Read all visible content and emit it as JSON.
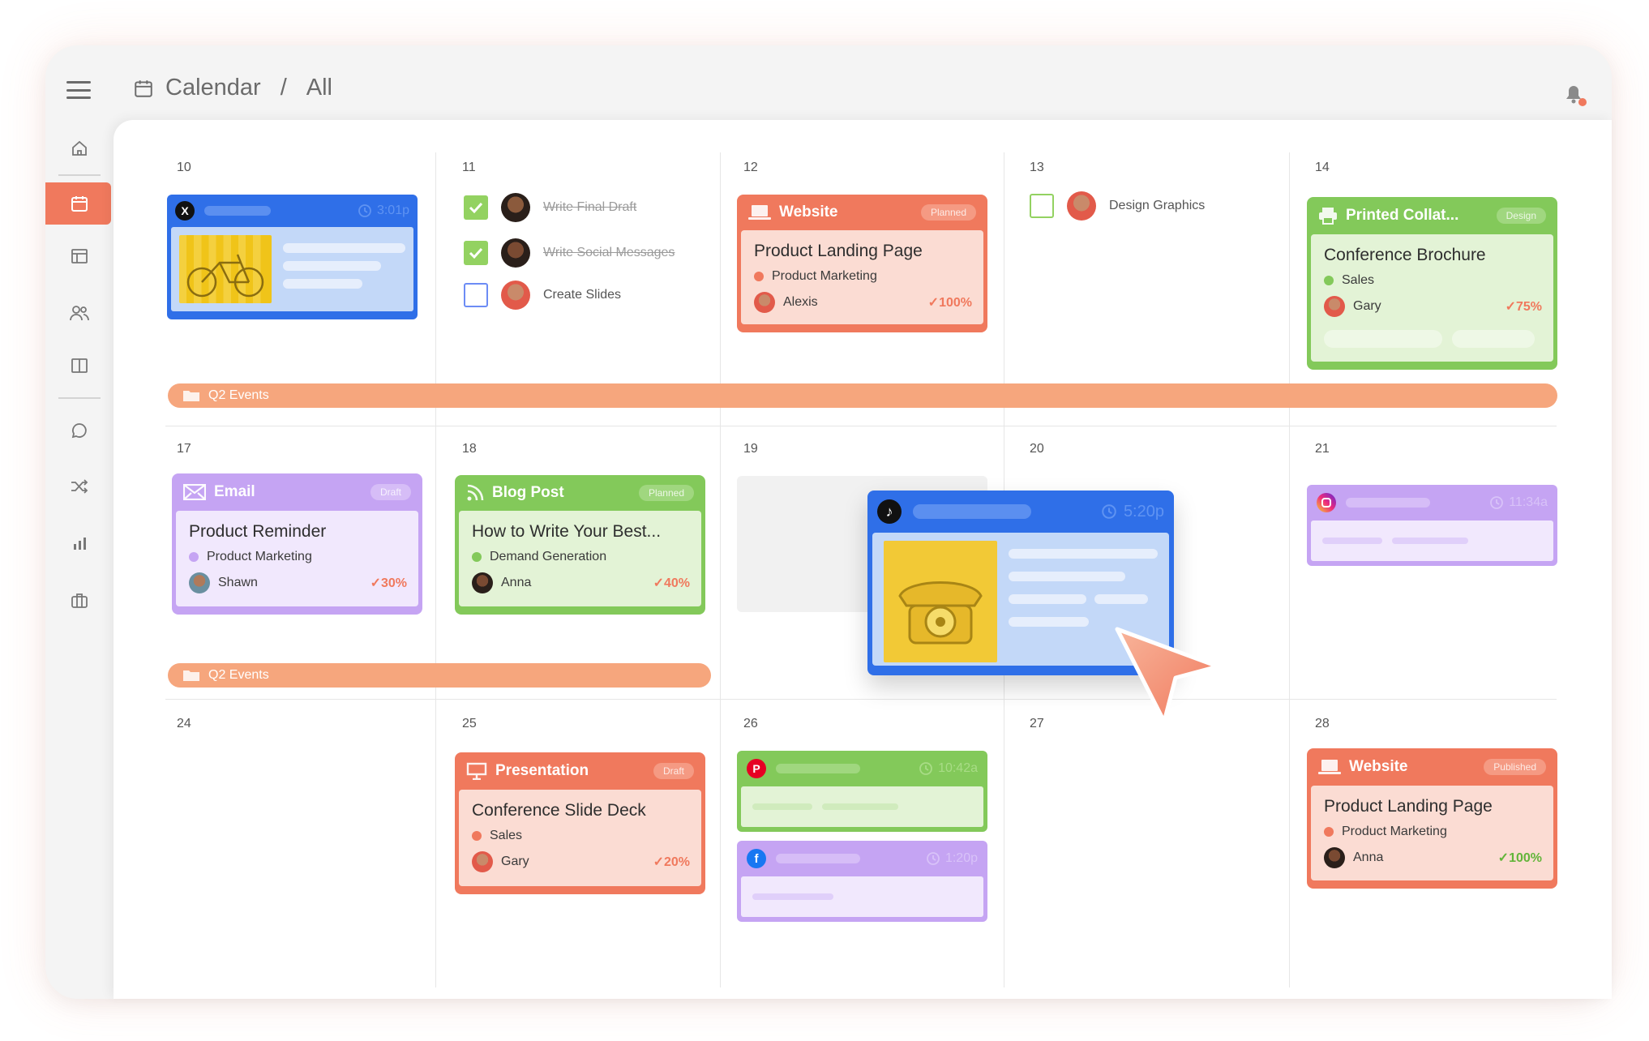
{
  "app": {
    "breadcrumb": {
      "root": "Calendar",
      "separator": "/",
      "current": "All"
    }
  },
  "colors": {
    "accent": "#f0795d",
    "blue": "#2f6fe8",
    "green": "#83c95a",
    "purple": "#c5a4f3",
    "orange": "#f0795d",
    "band": "#f6a67d"
  },
  "sidebar": {
    "items": [
      {
        "icon": "home-icon"
      },
      {
        "icon": "calendar-icon",
        "active": true
      },
      {
        "icon": "layout-icon"
      },
      {
        "icon": "people-icon"
      },
      {
        "icon": "columns-icon"
      },
      {
        "icon": "chat-icon"
      },
      {
        "icon": "shuffle-icon"
      },
      {
        "icon": "bar-chart-icon"
      },
      {
        "icon": "briefcase-icon"
      }
    ]
  },
  "weeks": [
    {
      "days": [
        "10",
        "11",
        "12",
        "13",
        "14"
      ],
      "band": "Q2 Events"
    },
    {
      "days": [
        "17",
        "18",
        "19",
        "20",
        "21"
      ],
      "band": "Q2 Events"
    },
    {
      "days": [
        "24",
        "25",
        "26",
        "27",
        "28"
      ]
    }
  ],
  "social": {
    "x_post": {
      "time": "3:01p",
      "platform": "x"
    },
    "tiktok_post": {
      "time": "5:20p",
      "platform": "tiktok"
    },
    "instagram_post": {
      "time": "11:34a",
      "platform": "instagram"
    },
    "pinterest_post": {
      "time": "10:42a",
      "platform": "pinterest"
    },
    "facebook_post": {
      "time": "1:20p",
      "platform": "facebook"
    }
  },
  "tasks": [
    {
      "label": "Write Final Draft",
      "done": true
    },
    {
      "label": "Write Social Messages",
      "done": true
    },
    {
      "label": "Create Slides",
      "done": false
    },
    {
      "label": "Design Graphics",
      "done": false
    }
  ],
  "cards": {
    "website_12": {
      "category": "Website",
      "status": "Planned",
      "title": "Product Landing Page",
      "tag": "Product Marketing",
      "owner": "Alexis",
      "progress": "100%",
      "progress_value": 100
    },
    "print_14": {
      "category": "Printed Collat...",
      "status": "Design",
      "title": "Conference Brochure",
      "tag": "Sales",
      "owner": "Gary",
      "progress": "75%",
      "progress_value": 75
    },
    "email_17": {
      "category": "Email",
      "status": "Draft",
      "title": "Product Reminder",
      "tag": "Product Marketing",
      "owner": "Shawn",
      "progress": "30%",
      "progress_value": 30
    },
    "blog_18": {
      "category": "Blog Post",
      "status": "Planned",
      "title": "How to Write Your Best...",
      "tag": "Demand Generation",
      "owner": "Anna",
      "progress": "40%",
      "progress_value": 40
    },
    "presentation_25": {
      "category": "Presentation",
      "status": "Draft",
      "title": "Conference Slide Deck",
      "tag": "Sales",
      "owner": "Gary",
      "progress": "20%",
      "progress_value": 20
    },
    "website_28": {
      "category": "Website",
      "status": "Published",
      "title": "Product Landing Page",
      "tag": "Product Marketing",
      "owner": "Anna",
      "progress": "100%",
      "progress_value": 100
    }
  }
}
